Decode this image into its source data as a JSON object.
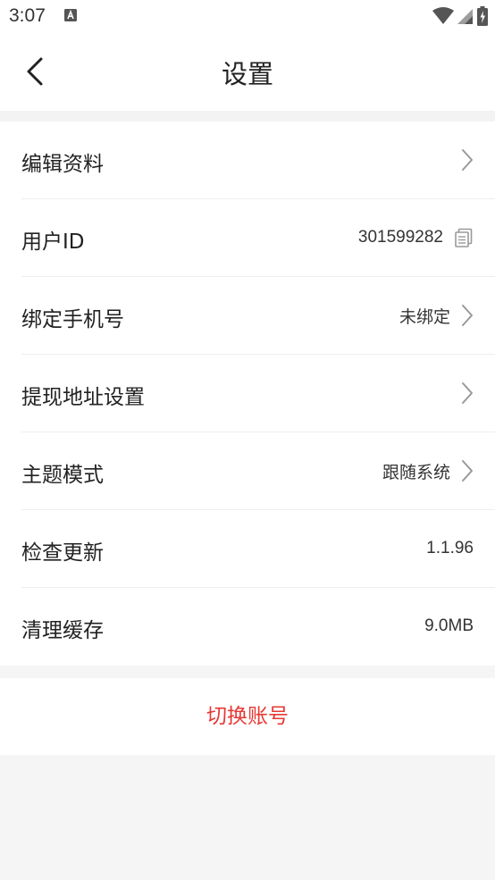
{
  "status_bar": {
    "time": "3:07"
  },
  "nav": {
    "title": "设置"
  },
  "settings": {
    "edit_profile": {
      "label": "编辑资料"
    },
    "user_id": {
      "label": "用户ID",
      "value": "301599282"
    },
    "bind_phone": {
      "label": "绑定手机号",
      "value": "未绑定"
    },
    "withdraw_address": {
      "label": "提现地址设置"
    },
    "theme_mode": {
      "label": "主题模式",
      "value": "跟随系统"
    },
    "check_update": {
      "label": "检查更新",
      "value": "1.1.96"
    },
    "clear_cache": {
      "label": "清理缓存",
      "value": "9.0MB"
    }
  },
  "switch_account": {
    "label": "切换账号"
  },
  "colors": {
    "accent_red": "#e53935",
    "background": "#f5f5f5"
  }
}
